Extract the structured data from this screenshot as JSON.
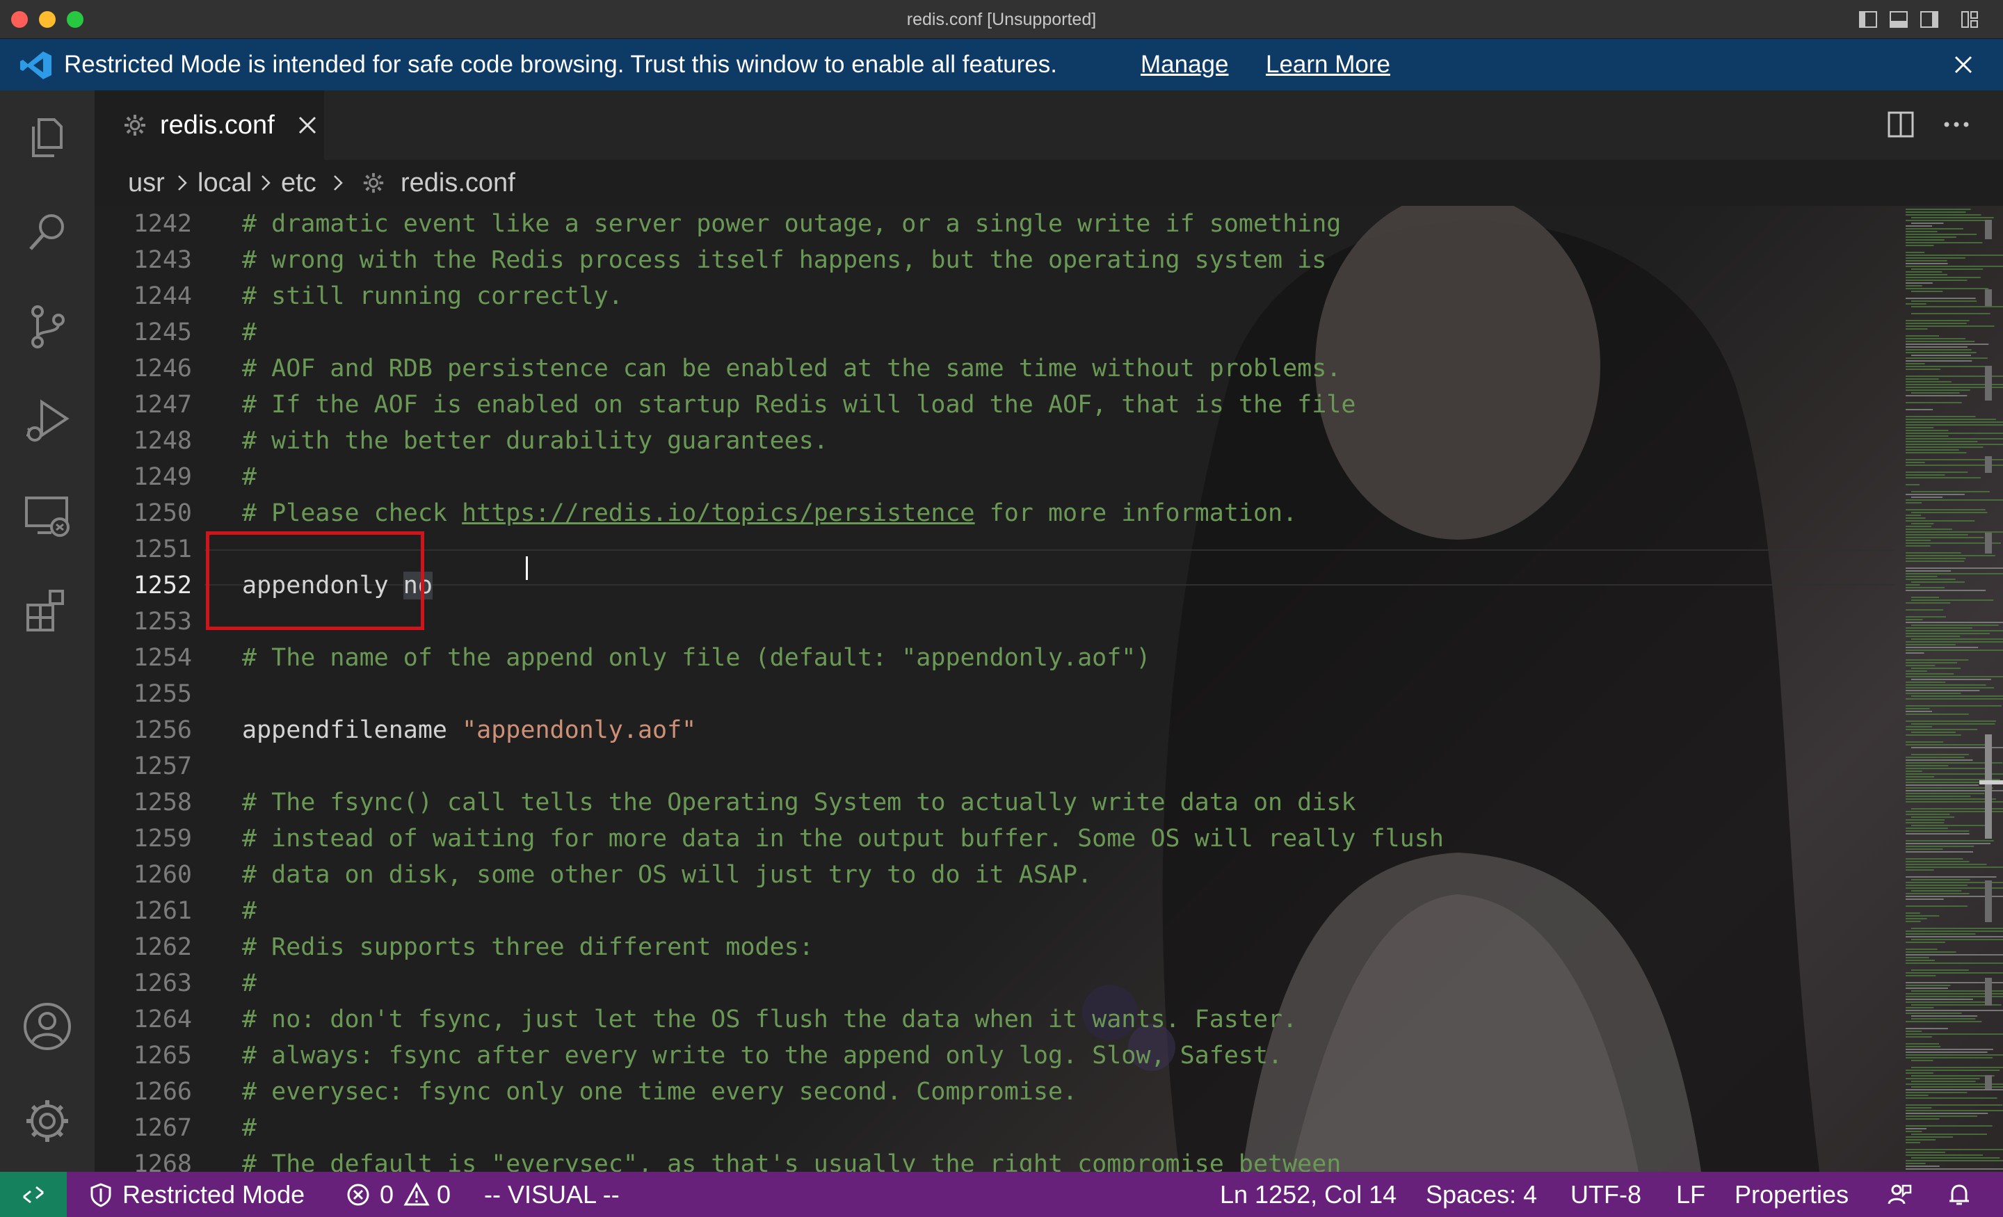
{
  "window": {
    "title": "redis.conf [Unsupported]"
  },
  "banner": {
    "message": "Restricted Mode is intended for safe code browsing. Trust this window to enable all features.",
    "manage_label": "Manage",
    "learn_more_label": "Learn More"
  },
  "tab": {
    "label": "redis.conf"
  },
  "breadcrumb": [
    "usr",
    "local",
    "etc",
    "redis.conf"
  ],
  "editor": {
    "current_line": "1252",
    "lines": [
      {
        "n": "1242",
        "text": "# dramatic event like a server power outage, or a single write if something"
      },
      {
        "n": "1243",
        "text": "# wrong with the Redis process itself happens, but the operating system is"
      },
      {
        "n": "1244",
        "text": "# still running correctly."
      },
      {
        "n": "1245",
        "text": "#"
      },
      {
        "n": "1246",
        "text": "# AOF and RDB persistence can be enabled at the same time without problems."
      },
      {
        "n": "1247",
        "text": "# If the AOF is enabled on startup Redis will load the AOF, that is the file"
      },
      {
        "n": "1248",
        "text": "# with the better durability guarantees."
      },
      {
        "n": "1249",
        "text": "#"
      },
      {
        "n": "1250",
        "text_before": "# Please check ",
        "link": "https://redis.io/topics/persistence",
        "text_after": " for more information."
      },
      {
        "n": "1251",
        "text": ""
      },
      {
        "n": "1252",
        "keyword": "appendonly",
        "value": "no"
      },
      {
        "n": "1253",
        "text": ""
      },
      {
        "n": "1254",
        "text": "# The name of the append only file (default: \"appendonly.aof\")"
      },
      {
        "n": "1255",
        "text": ""
      },
      {
        "n": "1256",
        "keyword": "appendfilename",
        "string": "\"appendonly.aof\""
      },
      {
        "n": "1257",
        "text": ""
      },
      {
        "n": "1258",
        "text": "# The fsync() call tells the Operating System to actually write data on disk"
      },
      {
        "n": "1259",
        "text": "# instead of waiting for more data in the output buffer. Some OS will really flush"
      },
      {
        "n": "1260",
        "text": "# data on disk, some other OS will just try to do it ASAP."
      },
      {
        "n": "1261",
        "text": "#"
      },
      {
        "n": "1262",
        "text": "# Redis supports three different modes:"
      },
      {
        "n": "1263",
        "text": "#"
      },
      {
        "n": "1264",
        "text": "# no: don't fsync, just let the OS flush the data when it wants. Faster."
      },
      {
        "n": "1265",
        "text": "# always: fsync after every write to the append only log. Slow, Safest."
      },
      {
        "n": "1266",
        "text": "# everysec: fsync only one time every second. Compromise."
      },
      {
        "n": "1267",
        "text": "#"
      },
      {
        "n": "1268",
        "text": "# The default is \"everysec\", as that's usually the right compromise between"
      }
    ]
  },
  "statusbar": {
    "restricted_mode": "Restricted Mode",
    "errors": "0",
    "warnings": "0",
    "vim_mode": "-- VISUAL --",
    "position": "Ln 1252, Col 14",
    "indentation": "Spaces: 4",
    "encoding": "UTF-8",
    "eol": "LF",
    "language": "Properties"
  },
  "colors": {
    "titlebar": "#323233",
    "banner": "#0e3a66",
    "activitybar": "#2c2c2c",
    "editor": "#1e1e1e",
    "statusbar": "#68217a",
    "remote_button": "#16825d",
    "comment": "#6a9955",
    "string": "#ce9178",
    "highlight_box": "#d0141b"
  },
  "icons": {
    "activity": [
      "explorer-icon",
      "search-icon",
      "source-control-icon",
      "run-debug-icon",
      "remote-explorer-icon",
      "extensions-icon",
      "account-icon",
      "settings-gear-icon"
    ]
  }
}
